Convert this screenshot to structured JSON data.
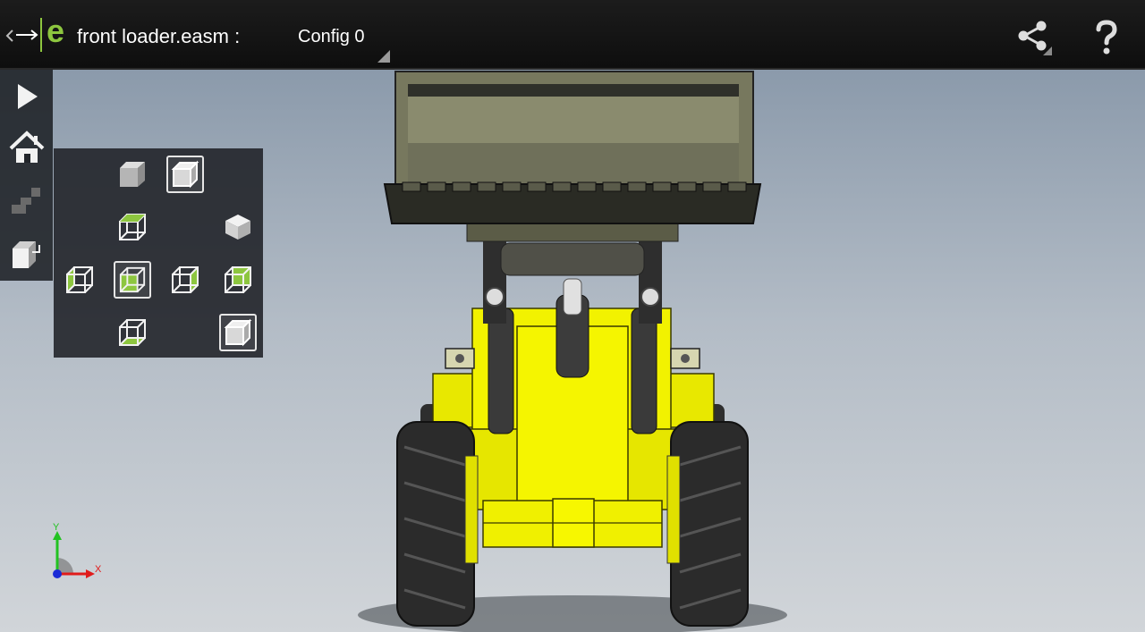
{
  "header": {
    "file_name": "front loader.easm :",
    "config": "Config 0"
  },
  "icons": {
    "app": "edrawings-logo-icon",
    "share": "share-icon",
    "help": "help-icon",
    "play": "play-icon",
    "home": "home-icon",
    "explode": "explode-icon",
    "views": "standard-views-icon"
  },
  "triad": {
    "x_label": "X",
    "y_label": "Y"
  },
  "colors": {
    "accent": "#8dc63f",
    "loader_body": "#f2f200",
    "bucket": "#66674f",
    "tire": "#2b2b2b"
  }
}
